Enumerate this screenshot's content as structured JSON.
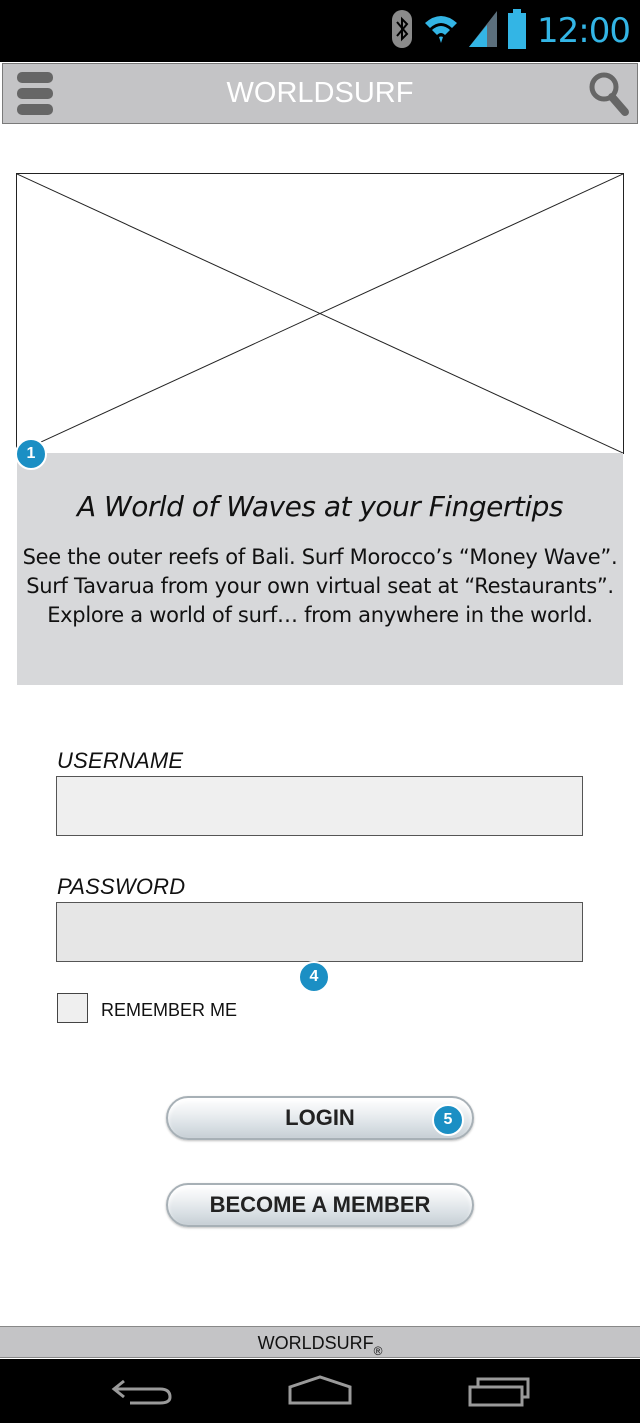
{
  "status_bar": {
    "time": "12:00",
    "icons": [
      "bluetooth-icon",
      "wifi-icon",
      "signal-icon",
      "battery-icon"
    ],
    "accent_color": "#33b5e5"
  },
  "app_bar": {
    "title": "WORLDSURF",
    "menu_icon": "hamburger-menu-icon",
    "search_icon": "search-icon"
  },
  "hero": {
    "image": "image-placeholder",
    "annotation": "1",
    "heading": "A World of Waves at your Fingertips",
    "lines": [
      "See the outer reefs of Bali. Surf Morocco’s “Money Wave”.",
      "Surf Tavarua from your own virtual seat at “Restaurants”.",
      "Explore a world of surf… from anywhere in the world."
    ]
  },
  "form": {
    "username_label": "USERNAME",
    "username_value": "",
    "password_label": "PASSWORD",
    "password_value": "",
    "annotation_password": "4",
    "remember_label": "REMEMBER ME",
    "remember_checked": false,
    "login_label": "LOGIN",
    "annotation_login": "5",
    "member_label": "BECOME A MEMBER"
  },
  "footer": {
    "brand": "WORLDSURF",
    "registered": "®"
  },
  "nav_bar": {
    "buttons": [
      "back-icon",
      "home-icon",
      "recent-apps-icon"
    ]
  }
}
